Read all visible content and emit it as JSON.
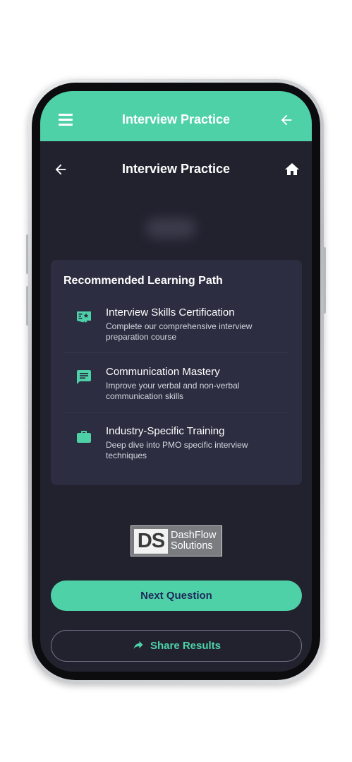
{
  "app_bar": {
    "title": "Interview Practice",
    "menu_icon": "hamburger-menu-icon",
    "back_icon": "arrow-left-icon"
  },
  "header": {
    "title": "Interview Practice",
    "back_icon": "arrow-left-icon",
    "home_icon": "home-icon"
  },
  "learning_path": {
    "title": "Recommended Learning Path",
    "items": [
      {
        "icon": "certificate-icon",
        "title": "Interview Skills Certification",
        "description": "Complete our comprehensive interview preparation course"
      },
      {
        "icon": "chat-message-icon",
        "title": "Communication Mastery",
        "description": "Improve your verbal and non-verbal communication skills"
      },
      {
        "icon": "briefcase-icon",
        "title": "Industry-Specific Training",
        "description": "Deep dive into PMO specific interview techniques"
      }
    ]
  },
  "logo": {
    "mark": "DS",
    "name_line1": "DashFlow",
    "name_line2": "Solutions"
  },
  "actions": {
    "next_label": "Next Question",
    "share_label": "Share Results",
    "share_icon": "share-arrow-icon"
  },
  "colors": {
    "accent": "#4fd1a8",
    "background": "#22222f",
    "card": "#2c2d40",
    "button_text": "#1f2a5a"
  }
}
